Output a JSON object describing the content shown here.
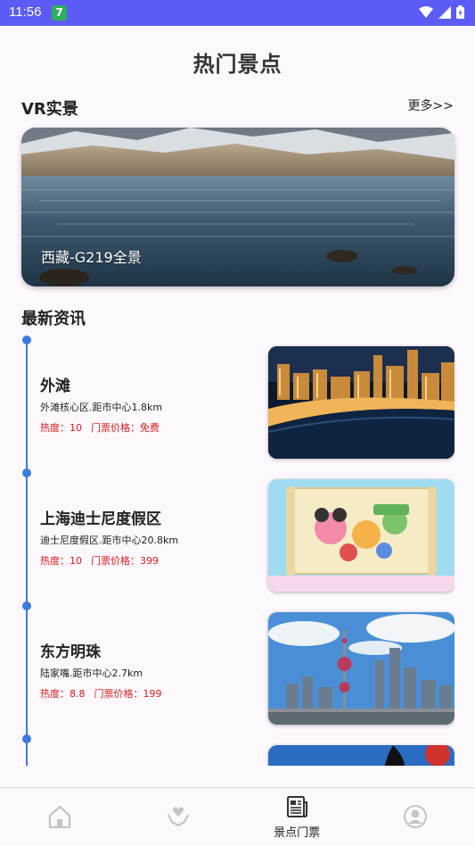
{
  "status_bar": {
    "time": "11:56",
    "notification_badge": "7"
  },
  "page": {
    "title": "热门景点"
  },
  "vr_section": {
    "title": "VR实景",
    "more_label": "更多>>",
    "card": {
      "caption": "西藏-G219全景"
    }
  },
  "news_section": {
    "title": "最新资讯",
    "items": [
      {
        "name": "外滩",
        "location": "外滩核心区.距市中心1.8km",
        "heat": "热度：10",
        "price": "门票价格：免费"
      },
      {
        "name": "上海迪士尼度假区",
        "location": "迪士尼度假区.距市中心20.8km",
        "heat": "热度：10",
        "price": "门票价格：399"
      },
      {
        "name": "东方明珠",
        "location": "陆家嘴.距市中心2.7km",
        "heat": "热度：8.8",
        "price": "门票价格：199"
      }
    ]
  },
  "tab_bar": {
    "tabs": [
      {
        "icon": "home-icon",
        "label": ""
      },
      {
        "icon": "heart-hand-icon",
        "label": ""
      },
      {
        "icon": "newspaper-icon",
        "label": "景点门票",
        "active": true
      },
      {
        "icon": "profile-icon",
        "label": ""
      }
    ]
  },
  "colors": {
    "status_bar": "#5b5bf6",
    "timeline": "#3b7be0",
    "price_text": "#e01b1b",
    "background": "#fdf8fd"
  }
}
